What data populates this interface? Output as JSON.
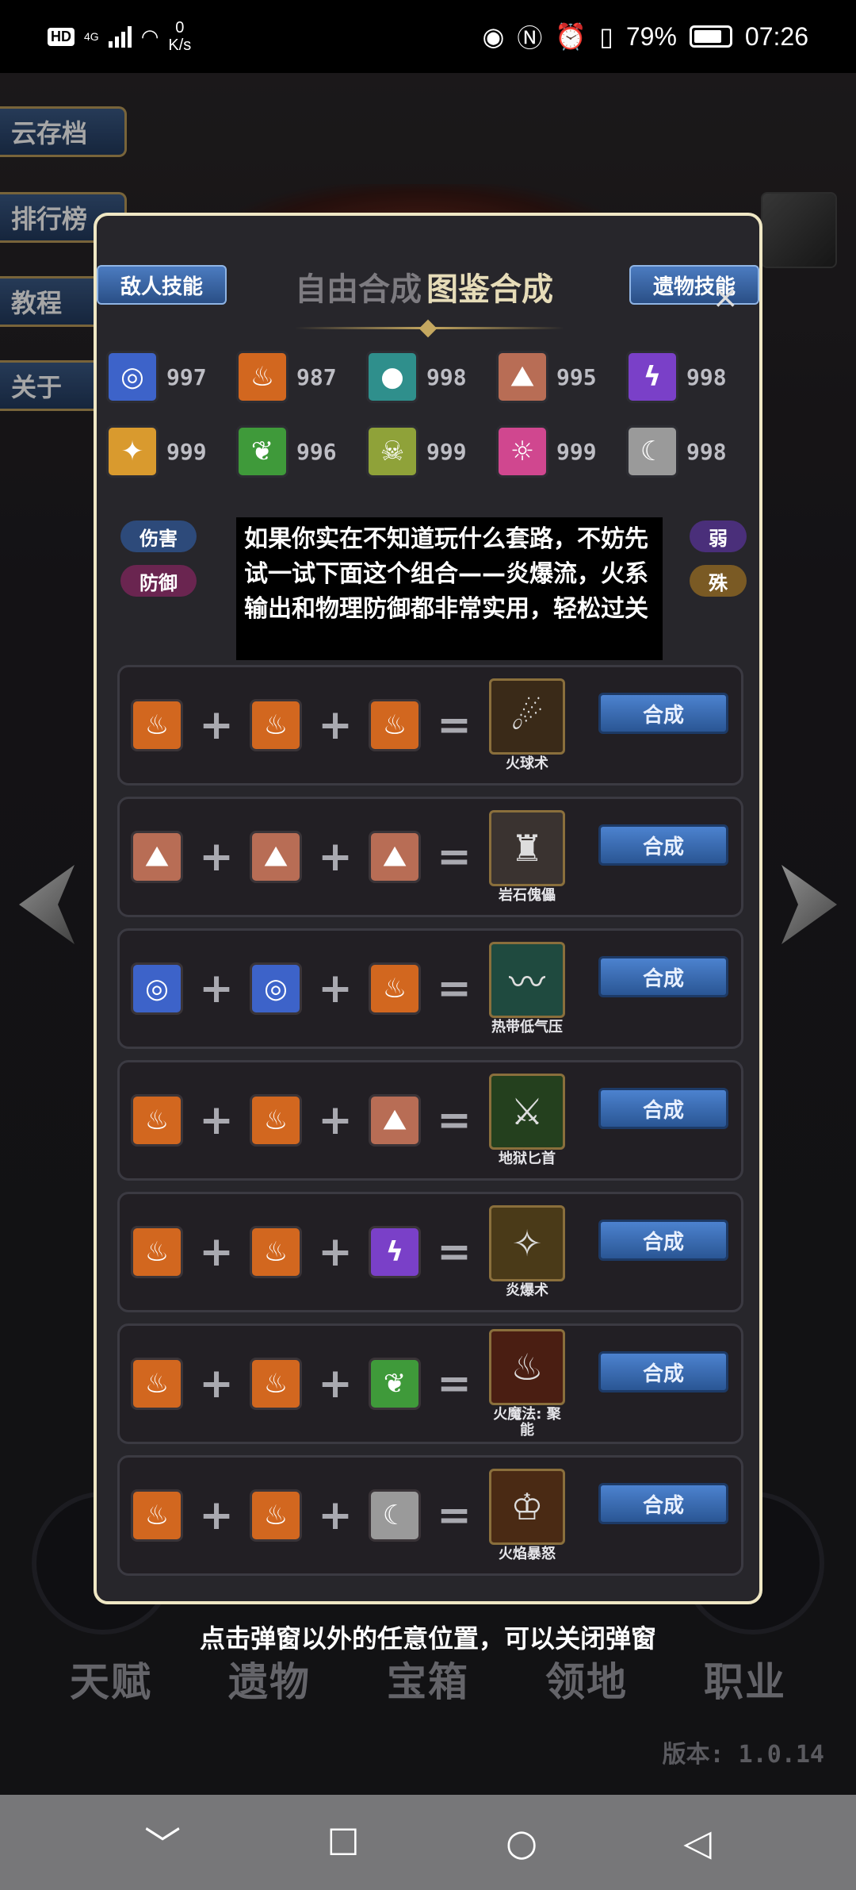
{
  "status_bar": {
    "hd": "HD",
    "net": "4G",
    "speed_value": "0",
    "speed_unit": "K/s",
    "battery": "79%",
    "time": "07:26"
  },
  "side_menu": [
    "云存档",
    "排行榜",
    "教程",
    "关于"
  ],
  "dialog": {
    "enemy_skill": "敌人技能",
    "relic_skill": "遗物技能",
    "close": "×",
    "mode_free": "自由合成",
    "mode_book": "图鉴合成",
    "elements": [
      {
        "icon": "tornado-icon",
        "glyph": "◎",
        "color": "#3d63c9",
        "count": "997"
      },
      {
        "icon": "fire-icon",
        "glyph": "♨",
        "color": "#d2671f",
        "count": "987"
      },
      {
        "icon": "water-drop-icon",
        "glyph": "●",
        "color": "#2f8f8c",
        "count": "998"
      },
      {
        "icon": "rock-icon",
        "glyph": "⛰",
        "color": "#b86d55",
        "count": "995"
      },
      {
        "icon": "lightning-icon",
        "glyph": "ϟ",
        "color": "#7a40c8",
        "count": "998"
      },
      {
        "icon": "light-icon",
        "glyph": "✦",
        "color": "#d99a2e",
        "count": "999"
      },
      {
        "icon": "leaf-icon",
        "glyph": "❦",
        "color": "#3f9a3a",
        "count": "996"
      },
      {
        "icon": "skull-icon",
        "glyph": "☠",
        "color": "#8fa239",
        "count": "999"
      },
      {
        "icon": "sun-icon",
        "glyph": "☼",
        "color": "#d0478f",
        "count": "999"
      },
      {
        "icon": "moon-icon",
        "glyph": "☾",
        "color": "#9a9a9a",
        "count": "998"
      }
    ],
    "filters": {
      "damage": "伤害",
      "defense": "防御",
      "weaken": "弱",
      "special": "殊"
    },
    "overlay_text": "如果你实在不知道玩什么套路，不妨先试一试下面这个组合——炎爆流，火系输出和物理防御都非常实用，轻松过关",
    "craft_label": "合成",
    "recipes": [
      {
        "inputs": [
          "fire",
          "fire",
          "fire"
        ],
        "result": "火球术",
        "result_glyph": "☄",
        "result_bg": "#3a2a18"
      },
      {
        "inputs": [
          "rock",
          "rock",
          "rock"
        ],
        "result": "岩石傀儡",
        "result_glyph": "♜",
        "result_bg": "#3a3330"
      },
      {
        "inputs": [
          "tornado",
          "tornado",
          "fire"
        ],
        "result": "热带低气压",
        "result_glyph": "〰",
        "result_bg": "#1f4a3f"
      },
      {
        "inputs": [
          "fire",
          "fire",
          "rock"
        ],
        "result": "地狱匕首",
        "result_glyph": "⚔",
        "result_bg": "#24401e"
      },
      {
        "inputs": [
          "fire",
          "fire",
          "lightning"
        ],
        "result": "炎爆术",
        "result_glyph": "✧",
        "result_bg": "#4a3a18"
      },
      {
        "inputs": [
          "fire",
          "fire",
          "leaf"
        ],
        "result": "火魔法: 聚能",
        "result_glyph": "♨",
        "result_bg": "#4a1e12"
      },
      {
        "inputs": [
          "fire",
          "fire",
          "moon"
        ],
        "result": "火焰暴怒",
        "result_glyph": "♔",
        "result_bg": "#4a2a14"
      }
    ]
  },
  "hint": "点击弹窗以外的任意位置，可以关闭弹窗",
  "bottom_tabs": [
    "天赋",
    "遗物",
    "宝箱",
    "领地",
    "职业"
  ],
  "version": "版本: 1.0.14",
  "nav": {
    "back": "﹀",
    "recent": "☐",
    "home": "○",
    "prev": "◁"
  }
}
